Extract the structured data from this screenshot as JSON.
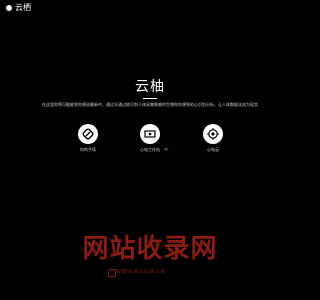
{
  "header": {
    "logo_text": "云栖"
  },
  "hero": {
    "title": "云柚",
    "description": "在这里你将可能能到你想说最新中，通过半通过练识别人体采集微感的生物你你想到的心识别分析，让人体数据化成为现实"
  },
  "features": [
    {
      "label": "你的手续",
      "icon": "link-icon"
    },
    {
      "label": "心电工作站",
      "icon": "monitor-icon"
    },
    {
      "label": "心电云",
      "icon": "cloud-icon"
    }
  ],
  "accent": {
    "arrow_glyph": "➜",
    "arrow_color": "#1fa34a"
  },
  "watermark": {
    "text": "网站收录网",
    "sub": "WWW.WZSLW.CN",
    "color": "#8a1c12"
  }
}
